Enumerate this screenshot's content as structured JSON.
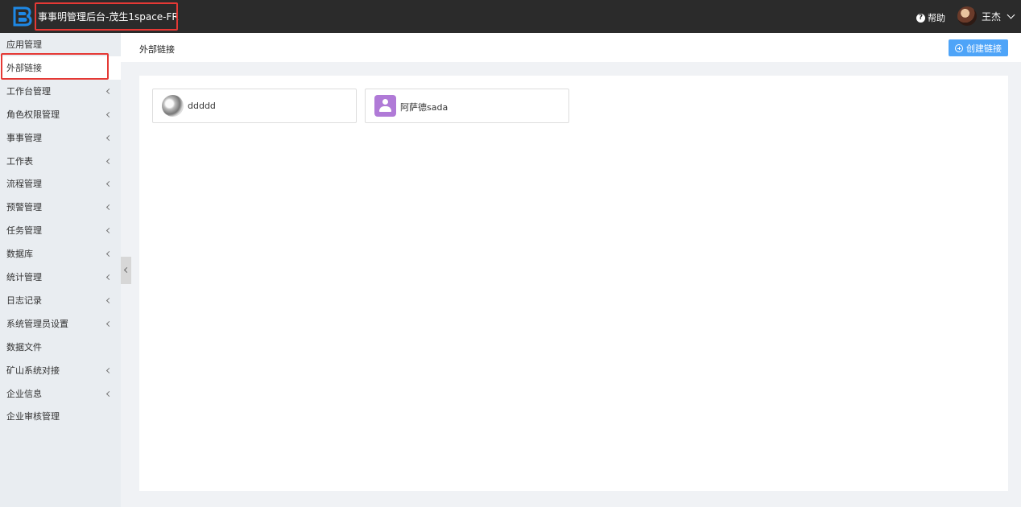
{
  "topbar": {
    "app_title": "事事明管理后台-茂生1space-FR",
    "help_label": "帮助",
    "user_name": "王杰"
  },
  "sidebar": {
    "items": [
      {
        "label": "应用管理",
        "has_arrow": false
      },
      {
        "label": "外部链接",
        "has_arrow": false,
        "active": true
      },
      {
        "label": "工作台管理",
        "has_arrow": true
      },
      {
        "label": "角色权限管理",
        "has_arrow": true
      },
      {
        "label": "事事管理",
        "has_arrow": true
      },
      {
        "label": "工作表",
        "has_arrow": true
      },
      {
        "label": "流程管理",
        "has_arrow": true
      },
      {
        "label": "预警管理",
        "has_arrow": true
      },
      {
        "label": "任务管理",
        "has_arrow": true
      },
      {
        "label": "数据库",
        "has_arrow": true
      },
      {
        "label": "统计管理",
        "has_arrow": true
      },
      {
        "label": "日志记录",
        "has_arrow": true
      },
      {
        "label": "系统管理员设置",
        "has_arrow": true
      },
      {
        "label": "数据文件",
        "has_arrow": false
      },
      {
        "label": "矿山系统对接",
        "has_arrow": true
      },
      {
        "label": "企业信息",
        "has_arrow": true
      },
      {
        "label": "企业审核管理",
        "has_arrow": false
      }
    ]
  },
  "header": {
    "page_title": "外部链接",
    "create_label": "创建链接"
  },
  "links": [
    {
      "label": "ddddd",
      "icon": "photo-avatar-icon"
    },
    {
      "label": "阿萨德sada",
      "icon": "person-icon"
    }
  ],
  "colors": {
    "topbar_bg": "#2b2b2b",
    "sidebar_bg": "#e9edf1",
    "accent": "#4ea4f8",
    "highlight": "#e53935",
    "person_icon_bg": "#b07ad7"
  }
}
